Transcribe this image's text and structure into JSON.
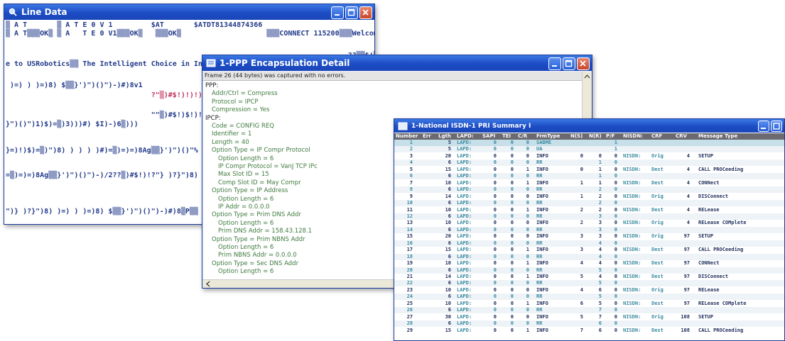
{
  "line_window": {
    "title": "Line Data",
    "lines": [
      "▒ A T       ▒ A T E 0 V 1         $AT       $ATDT81344874366",
      "▒ A T▒▒▒OK▒ ▒ A   T E 0 V1▒▒▒OK▒   ▒▒▒OK▒                    ▒▒▒CONNECT 115200▒▒▒Welcom",
      "                                                                                ??▒▒$!▒!▒▒)  )?\"}8)",
      "e to USRobotics▒▒ The Intelligent Choice in In",
      " )=) ) )=)8) $▒▒}')\")()\")-)#)8v1",
      "                                  ?\"▒)#$!)!)!)",
      "                                  \"\"▒)#$!)$!)!)",
      "}\")()\")1)$)=▒)3)))#) $I)-)6▒)))",
      "}=)!)$)=▒)\")8) ) ) ) )#)=▒)=)=)8Ag▒▒}')\")()\"%",
      "=▒)=)=)8Ag▒▒}')\")()\")-)/2??▒)#$!)!?\"} )?}\")8) )",
      "\")} )?}\")8) )=) ) )=)8) $▒▒}')\")()\")-)#)8▒P▒▒"
    ]
  },
  "ppp_window": {
    "title": "1-PPP Encapsulation Detail",
    "status": "Frame 26 (44 bytes) was captured with no errors.",
    "rows": [
      {
        "text": "PPP:",
        "indent": 0
      },
      {
        "text": "Addr/Ctrl = Compress",
        "indent": 1
      },
      {
        "text": "Protocol = IPCP",
        "indent": 1
      },
      {
        "text": "Compression = Yes",
        "indent": 1
      },
      {
        "text": "IPCP:",
        "indent": 0
      },
      {
        "text": "Code = CONFIG REQ",
        "indent": 1
      },
      {
        "text": "Identifier = 1",
        "indent": 1
      },
      {
        "text": "Length = 40",
        "indent": 1
      },
      {
        "text": "Option Type = IP Compr Protocol",
        "indent": 1
      },
      {
        "text": "Option Length = 6",
        "indent": 2
      },
      {
        "text": "IP Compr Protocol = VanJ TCP IPc",
        "indent": 2
      },
      {
        "text": "Max Slot ID = 15",
        "indent": 2
      },
      {
        "text": "Comp Slot ID = May Compr",
        "indent": 2
      },
      {
        "text": "Option Type = IP Address",
        "indent": 1
      },
      {
        "text": "Option Length = 6",
        "indent": 2
      },
      {
        "text": "IP Addr = 0.0.0.0",
        "indent": 2
      },
      {
        "text": "Option Type = Prim DNS Addr",
        "indent": 1
      },
      {
        "text": "Option Length = 6",
        "indent": 2
      },
      {
        "text": "Prim DNS Addr = 158.43.128.1",
        "indent": 2
      },
      {
        "text": "Option Type = Prim NBNS Addr",
        "indent": 1
      },
      {
        "text": "Option Length = 6",
        "indent": 2
      },
      {
        "text": "Prim NBNS Addr = 0.0.0.0",
        "indent": 2
      },
      {
        "text": "Option Type = Sec DNS Addr",
        "indent": 1
      },
      {
        "text": "Option Length = 6",
        "indent": 2
      }
    ]
  },
  "isdn_window": {
    "title": "1-National ISDN-1 PRI Summary I",
    "columns": [
      "Number",
      "Err",
      "Lgth",
      "LAPD:",
      "SAPI",
      "TEI",
      "C/R",
      "FrmType",
      "N(S)",
      "N(R)",
      "P/F",
      "NISDN:",
      "CRF",
      "CRV",
      "Message Type"
    ],
    "rows": [
      [
        "1",
        "",
        "5",
        "LAPD:",
        "0",
        "0",
        "0",
        "SABME",
        "",
        "",
        "1",
        "",
        "",
        "",
        ""
      ],
      [
        "2",
        "",
        "5",
        "LAPD:",
        "0",
        "0",
        "0",
        "UA",
        "",
        "",
        "1",
        "",
        "",
        "",
        ""
      ],
      [
        "3",
        "",
        "20",
        "LAPD:",
        "0",
        "0",
        "0",
        "INFO",
        "0",
        "0",
        "0",
        "NISDN:",
        "Orig",
        "4",
        "SETUP"
      ],
      [
        "4",
        "",
        "6",
        "LAPD:",
        "0",
        "0",
        "0",
        "RR",
        "",
        "1",
        "0",
        "",
        "",
        "",
        ""
      ],
      [
        "5",
        "",
        "15",
        "LAPD:",
        "0",
        "0",
        "1",
        "INFO",
        "0",
        "1",
        "0",
        "NISDN:",
        "Dest",
        "4",
        "CALL PROCeeding"
      ],
      [
        "6",
        "",
        "6",
        "LAPD:",
        "0",
        "0",
        "0",
        "RR",
        "",
        "1",
        "0",
        "",
        "",
        "",
        ""
      ],
      [
        "7",
        "",
        "10",
        "LAPD:",
        "0",
        "0",
        "1",
        "INFO",
        "1",
        "1",
        "0",
        "NISDN:",
        "Dest",
        "4",
        "CONNect"
      ],
      [
        "8",
        "",
        "6",
        "LAPD:",
        "0",
        "0",
        "0",
        "RR",
        "",
        "2",
        "0",
        "",
        "",
        "",
        ""
      ],
      [
        "9",
        "",
        "14",
        "LAPD:",
        "0",
        "0",
        "0",
        "INFO",
        "1",
        "2",
        "0",
        "NISDN:",
        "Orig",
        "4",
        "DISConnect"
      ],
      [
        "10",
        "",
        "6",
        "LAPD:",
        "0",
        "0",
        "0",
        "RR",
        "",
        "2",
        "0",
        "",
        "",
        "",
        ""
      ],
      [
        "11",
        "",
        "10",
        "LAPD:",
        "0",
        "0",
        "1",
        "INFO",
        "2",
        "2",
        "0",
        "NISDN:",
        "Dest",
        "4",
        "RELease"
      ],
      [
        "12",
        "",
        "6",
        "LAPD:",
        "0",
        "0",
        "0",
        "RR",
        "",
        "3",
        "0",
        "",
        "",
        "",
        ""
      ],
      [
        "13",
        "",
        "10",
        "LAPD:",
        "0",
        "0",
        "0",
        "INFO",
        "2",
        "3",
        "0",
        "NISDN:",
        "Orig",
        "4",
        "RELease COMplete"
      ],
      [
        "14",
        "",
        "6",
        "LAPD:",
        "0",
        "0",
        "0",
        "RR",
        "",
        "3",
        "0",
        "",
        "",
        "",
        ""
      ],
      [
        "15",
        "",
        "20",
        "LAPD:",
        "0",
        "0",
        "0",
        "INFO",
        "3",
        "3",
        "0",
        "NISDN:",
        "Orig",
        "97",
        "SETUP"
      ],
      [
        "16",
        "",
        "6",
        "LAPD:",
        "0",
        "0",
        "0",
        "RR",
        "",
        "4",
        "0",
        "",
        "",
        "",
        ""
      ],
      [
        "17",
        "",
        "15",
        "LAPD:",
        "0",
        "0",
        "1",
        "INFO",
        "3",
        "4",
        "0",
        "NISDN:",
        "Dest",
        "97",
        "CALL PROCeeding"
      ],
      [
        "18",
        "",
        "6",
        "LAPD:",
        "0",
        "0",
        "0",
        "RR",
        "",
        "4",
        "0",
        "",
        "",
        "",
        ""
      ],
      [
        "19",
        "",
        "10",
        "LAPD:",
        "0",
        "0",
        "1",
        "INFO",
        "4",
        "4",
        "0",
        "NISDN:",
        "Dest",
        "97",
        "CONNect"
      ],
      [
        "20",
        "",
        "6",
        "LAPD:",
        "0",
        "0",
        "0",
        "RR",
        "",
        "5",
        "0",
        "",
        "",
        "",
        ""
      ],
      [
        "21",
        "",
        "14",
        "LAPD:",
        "0",
        "0",
        "1",
        "INFO",
        "5",
        "4",
        "0",
        "NISDN:",
        "Dest",
        "97",
        "DISConnect"
      ],
      [
        "22",
        "",
        "6",
        "LAPD:",
        "0",
        "0",
        "0",
        "RR",
        "",
        "5",
        "0",
        "",
        "",
        "",
        ""
      ],
      [
        "23",
        "",
        "10",
        "LAPD:",
        "0",
        "0",
        "0",
        "INFO",
        "4",
        "6",
        "0",
        "NISDN:",
        "Orig",
        "97",
        "RELease"
      ],
      [
        "24",
        "",
        "6",
        "LAPD:",
        "0",
        "0",
        "0",
        "RR",
        "",
        "5",
        "0",
        "",
        "",
        "",
        ""
      ],
      [
        "25",
        "",
        "10",
        "LAPD:",
        "0",
        "0",
        "1",
        "INFO",
        "6",
        "5",
        "0",
        "NISDN:",
        "Dest",
        "97",
        "RELease COMplete"
      ],
      [
        "26",
        "",
        "6",
        "LAPD:",
        "0",
        "0",
        "0",
        "RR",
        "",
        "7",
        "0",
        "",
        "",
        "",
        ""
      ],
      [
        "27",
        "",
        "30",
        "LAPD:",
        "0",
        "0",
        "0",
        "INFO",
        "5",
        "7",
        "0",
        "NISDN:",
        "Orig",
        "108",
        "SETUP"
      ],
      [
        "28",
        "",
        "6",
        "LAPD:",
        "0",
        "0",
        "0",
        "RR",
        "",
        "6",
        "0",
        "",
        "",
        "",
        ""
      ],
      [
        "29",
        "",
        "15",
        "LAPD:",
        "0",
        "0",
        "1",
        "INFO",
        "7",
        "6",
        "0",
        "NISDN:",
        "Dest",
        "108",
        "CALL PROCeeding"
      ]
    ]
  },
  "icons": {
    "window_controls": [
      "minimize-icon",
      "maximize-icon",
      "close-icon"
    ]
  }
}
